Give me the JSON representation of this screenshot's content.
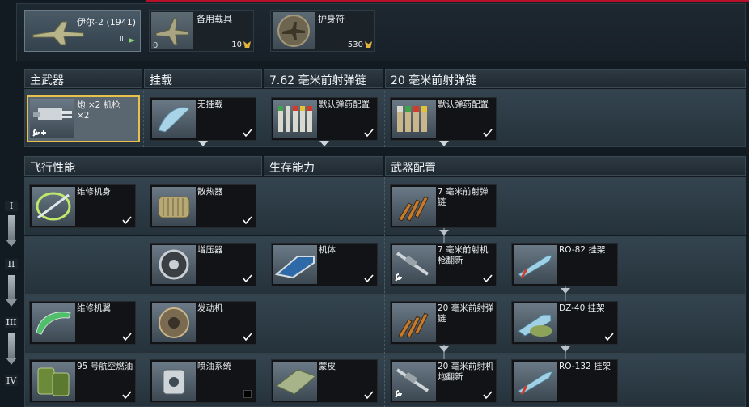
{
  "vehicle": {
    "name": "伊尔-2 (1941)",
    "rank": "II"
  },
  "top_items": [
    {
      "label": "备用载具",
      "count": "0",
      "cost": "10"
    },
    {
      "label": "护身符",
      "cost": "530"
    }
  ],
  "loadout_headers": [
    "主武器",
    "挂载",
    "7.62 毫米前射弹链",
    "20 毫米前射弹链"
  ],
  "loadout": [
    {
      "label": "炮 ×2 机枪 ×2",
      "icon": "cannon-icon"
    },
    {
      "label": "无挂载",
      "icon": "wing-icon"
    },
    {
      "label": "默认弹药配置",
      "icon": "ammo-belt-icon"
    },
    {
      "label": "默认弹药配置",
      "icon": "ammo-belt-icon"
    }
  ],
  "mod_headers": [
    "飞行性能",
    "生存能力",
    "武器配置"
  ],
  "tiers": [
    "I",
    "II",
    "III",
    "IV"
  ],
  "modules": {
    "flight": [
      "维修机身",
      "散热器",
      "增压器",
      "维修机翼",
      "发动机",
      "95 号航空燃油",
      "喷油系统"
    ],
    "survival": [
      "机体",
      "蒙皮"
    ],
    "weapons": [
      "7 毫米前射弹链",
      "7 毫米前射机枪翻新",
      "RO-82 挂架",
      "20 毫米前射弹链",
      "DZ-40 挂架",
      "20 毫米前射机炮翻新",
      "RO-132 挂架"
    ]
  },
  "colors": {
    "accent": "#e8c14a",
    "topline": "#b8102a",
    "eagle": "#e0b43c"
  }
}
